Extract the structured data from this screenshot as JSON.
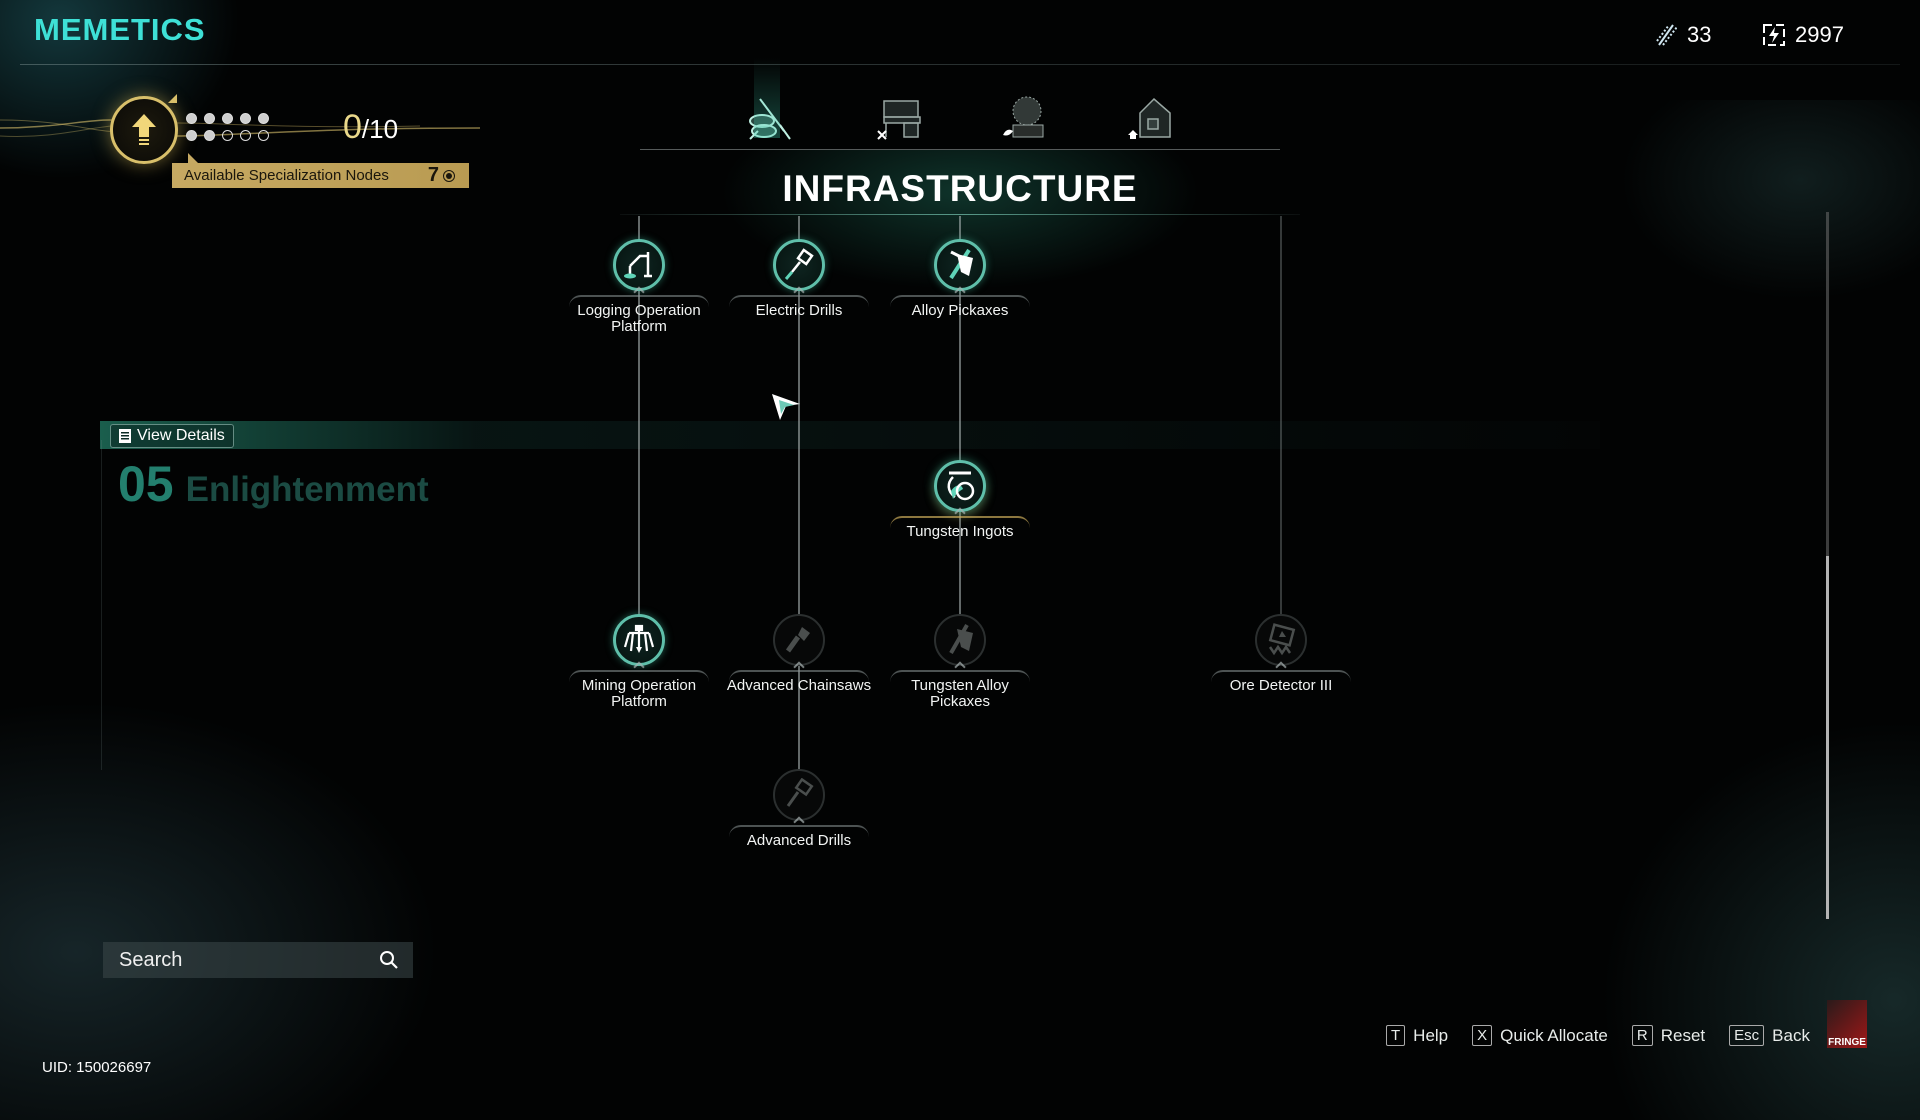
{
  "header": {
    "title": "MEMETICS",
    "resources": [
      {
        "icon": "dna-icon",
        "value": "33"
      },
      {
        "icon": "energy-icon",
        "value": "2997"
      }
    ]
  },
  "level": {
    "icon": "upgrade-arrow-icon",
    "dots_filled": 7,
    "dots_total": 10,
    "current": "0",
    "max": "/10",
    "spec_label": "Available Specialization Nodes",
    "spec_count": "7"
  },
  "tabs": [
    {
      "name": "infrastructure",
      "icon": "chainsaw-logs-icon",
      "active": true
    },
    {
      "name": "workbench",
      "icon": "workbench-icon",
      "active": false
    },
    {
      "name": "farming",
      "icon": "plant-icon",
      "active": false
    },
    {
      "name": "housing",
      "icon": "house-icon",
      "active": false
    }
  ],
  "section_title": "INFRASTRUCTURE",
  "details": {
    "view_details_label": "View Details",
    "tier_number": "05",
    "tier_name": "Enlightenment"
  },
  "nodes": [
    {
      "label": "Logging Operation Platform",
      "icon": "logging-platform-icon",
      "state": "unlocked"
    },
    {
      "label": "Electric Drills",
      "icon": "electric-drill-icon",
      "state": "unlocked"
    },
    {
      "label": "Alloy Pickaxes",
      "icon": "pickaxe-icon",
      "state": "unlocked"
    },
    {
      "label": "Tungsten Ingots",
      "icon": "ingot-icon",
      "state": "unlocked"
    },
    {
      "label": "Mining Operation Platform",
      "icon": "mining-platform-icon",
      "state": "unlocked"
    },
    {
      "label": "Advanced Chainsaws",
      "icon": "chainsaw-icon",
      "state": "locked"
    },
    {
      "label": "Tungsten Alloy Pickaxes",
      "icon": "pickaxe-icon",
      "state": "locked"
    },
    {
      "label": "Ore Detector III",
      "icon": "ore-detector-icon",
      "state": "locked"
    },
    {
      "label": "Advanced Drills",
      "icon": "drill-icon",
      "state": "locked"
    }
  ],
  "search": {
    "placeholder": "Search",
    "value": ""
  },
  "uid": "UID: 150026697",
  "footer": {
    "keys": [
      {
        "key": "T",
        "label": "Help"
      },
      {
        "key": "X",
        "label": "Quick Allocate"
      },
      {
        "key": "R",
        "label": "Reset"
      },
      {
        "key": "Esc",
        "label": "Back"
      }
    ],
    "logo_text": "FRINGE"
  },
  "scroll": {
    "position": 1.0,
    "visible_fraction": 0.51
  }
}
